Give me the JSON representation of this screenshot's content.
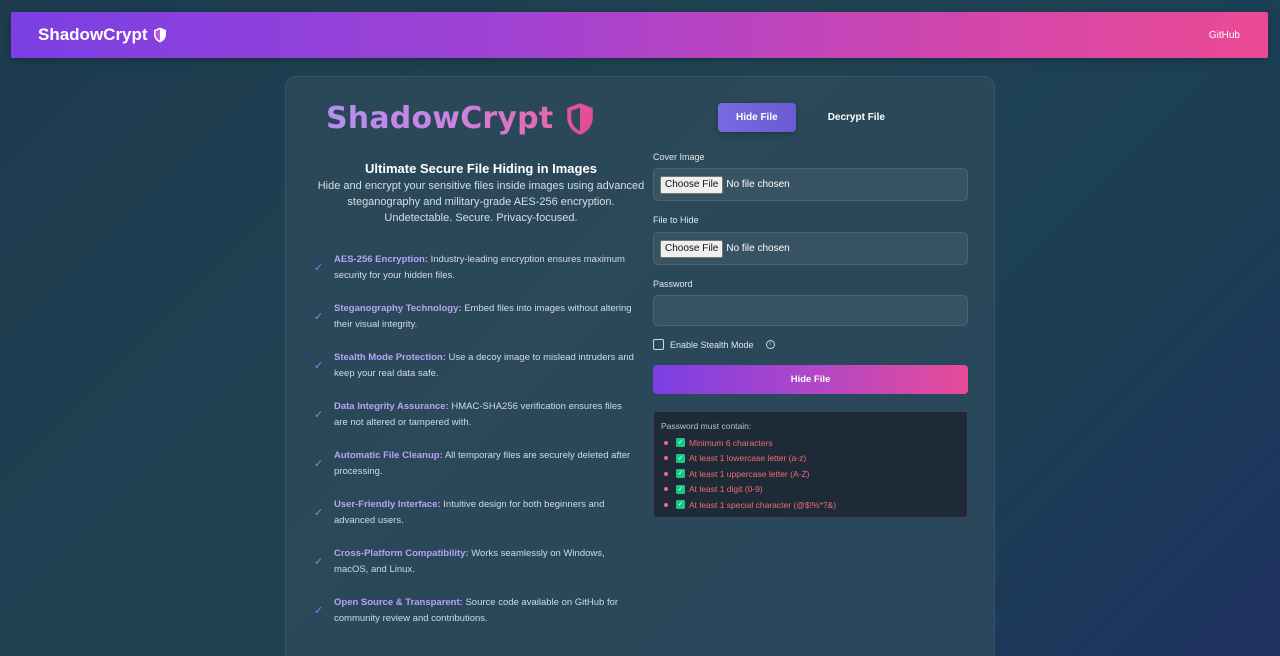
{
  "navbar": {
    "brand": "ShadowCrypt",
    "brand_icon": "shield-icon",
    "github_link": "GitHub"
  },
  "hero": {
    "logo_text": "ShadowCrypt",
    "logo_icon": "shield-icon",
    "title": "Ultimate Secure File Hiding in Images",
    "description": "Hide and encrypt your sensitive files inside images using advanced steganography and military-grade AES-256 encryption. Undetectable. Secure. Privacy-focused."
  },
  "features": [
    {
      "title": "AES-256 Encryption:",
      "text": " Industry-leading encryption ensures maximum security for your hidden files."
    },
    {
      "title": "Steganography Technology:",
      "text": " Embed files into images without altering their visual integrity."
    },
    {
      "title": "Stealth Mode Protection:",
      "text": " Use a decoy image to mislead intruders and keep your real data safe."
    },
    {
      "title": "Data Integrity Assurance:",
      "text": " HMAC-SHA256 verification ensures files are not altered or tampered with."
    },
    {
      "title": "Automatic File Cleanup:",
      "text": " All temporary files are securely deleted after processing."
    },
    {
      "title": "User-Friendly Interface:",
      "text": " Intuitive design for both beginners and advanced users."
    },
    {
      "title": "Cross-Platform Compatibility:",
      "text": " Works seamlessly on Windows, macOS, and Linux."
    },
    {
      "title": "Open Source & Transparent:",
      "text": " Source code available on GitHub for community review and contributions."
    }
  ],
  "tabs": {
    "hide": "Hide File",
    "decrypt": "Decrypt File"
  },
  "form": {
    "cover_label": "Cover Image",
    "file_label": "File to Hide",
    "choose_file": "Choose File",
    "no_file": "No file chosen",
    "password_label": "Password",
    "password_value": "",
    "stealth_label": "Enable Stealth Mode",
    "submit": "Hide File"
  },
  "password_rules": {
    "title": "Password must contain:",
    "items": [
      "Minimum 6 characters",
      "At least 1 lowercase letter (a-z)",
      "At least 1 uppercase letter (A-Z)",
      "At least 1 digit (0-9)",
      "At least 1 special character (@$!%*?&)"
    ]
  },
  "colors": {
    "accent_purple": "#7b3fe4",
    "accent_pink": "#ea4a94",
    "rule_red": "#f06d6d",
    "rule_check_green": "#16c784"
  }
}
